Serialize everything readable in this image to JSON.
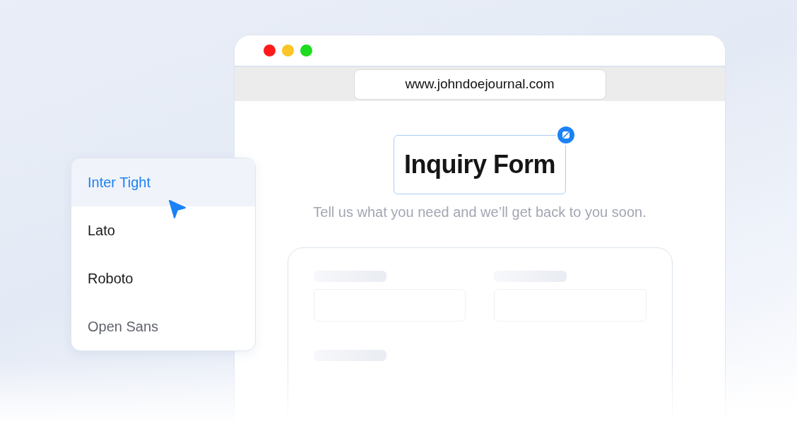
{
  "browser": {
    "url": "www.johndoejournal.com"
  },
  "page": {
    "title": "Inquiry Form",
    "title_selected": true,
    "subtitle": "Tell us what you need and we’ll get back to you soon."
  },
  "font_menu": {
    "items": [
      {
        "label": "Inter Tight",
        "selected": true,
        "disabled": false
      },
      {
        "label": "Lato",
        "selected": false,
        "disabled": false
      },
      {
        "label": "Roboto",
        "selected": false,
        "disabled": false
      },
      {
        "label": "Open Sans",
        "selected": false,
        "disabled": true
      }
    ]
  }
}
